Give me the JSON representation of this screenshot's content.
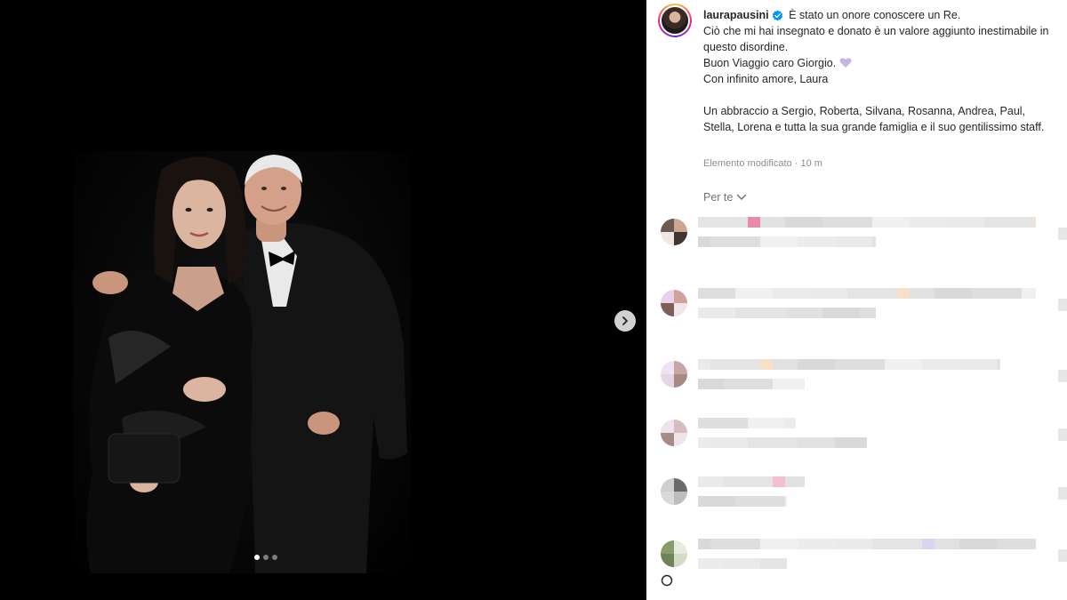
{
  "post": {
    "username": "laurapausini",
    "caption_lines": [
      "È stato un onore conoscere un Re.",
      "Ciò che mi hai insegnato e donato è un valore aggiunto inestimabile in questo disordine.",
      "Buon Viaggio caro Giorgio.",
      "Con infinito amore, Laura"
    ],
    "caption_second_paragraph": "Un abbraccio a Sergio, Roberta, Silvana, Rosanna, Andrea, Paul, Stella, Lorena e tutta la sua grande famiglia e il suo gentilissimo staff.",
    "edited_label": "Elemento modificato",
    "separator": "·",
    "time_ago": "10 m",
    "heart_emoji_color": "#c9b4e0"
  },
  "comments_filter": {
    "label": "Per te"
  },
  "carousel": {
    "slide_count": 3,
    "active_slide": 1
  },
  "colors": {
    "verified_badge": "#0095f6",
    "text_primary": "#262626",
    "text_secondary": "#8e8e8e",
    "photo_background": "#000000"
  },
  "icons": {
    "next": "chevron-right-icon",
    "verified": "verified-badge-icon",
    "filter_chevron": "chevron-down-icon",
    "heart": "purple-heart-icon"
  },
  "comments_count_visible": 6
}
